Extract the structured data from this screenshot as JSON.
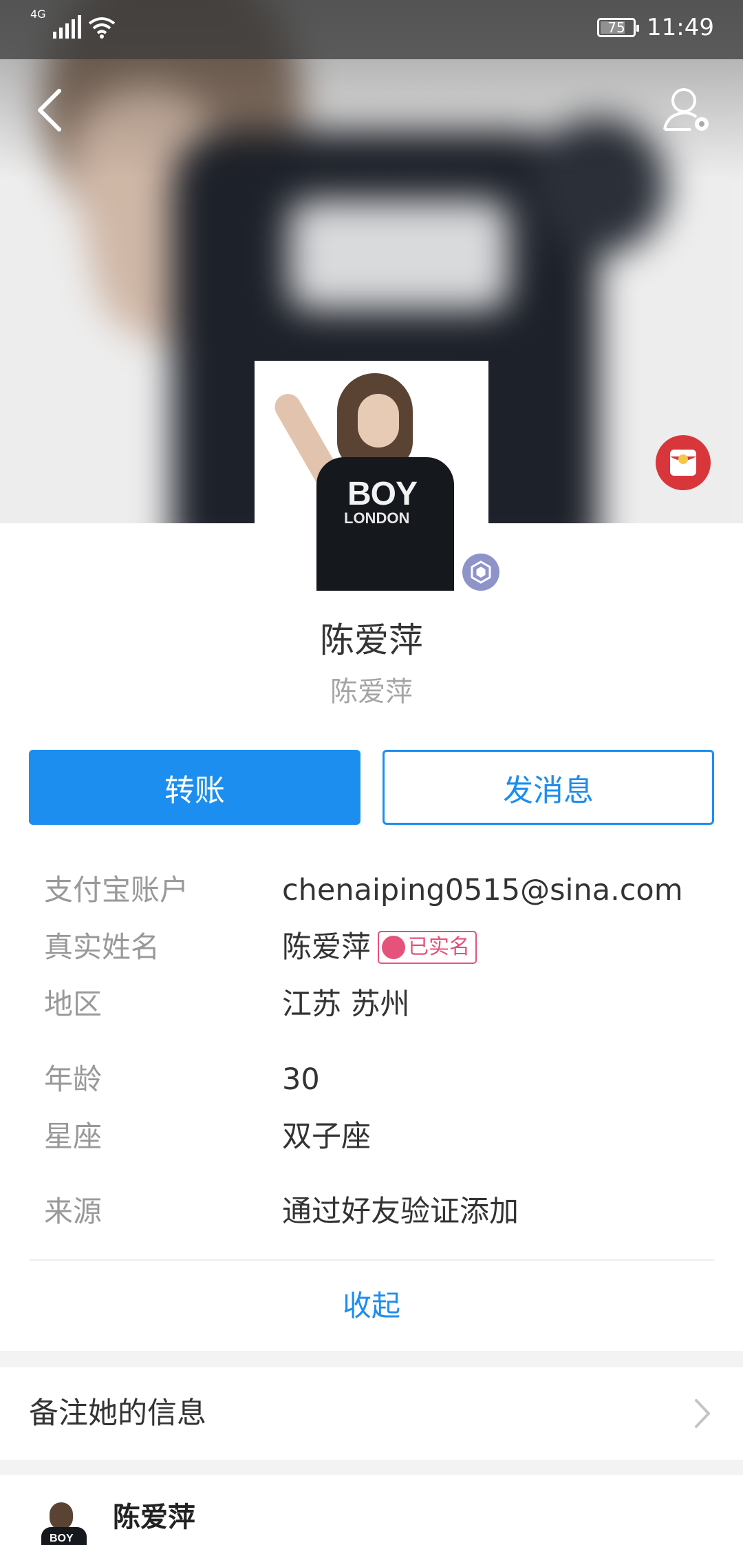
{
  "status_bar": {
    "network": "4G",
    "battery": "75",
    "time": "11:49"
  },
  "profile": {
    "display_name": "陈爱萍",
    "nickname": "陈爱萍",
    "avatar_shirt_text": "BOY",
    "avatar_shirt_subtext": "LONDON"
  },
  "actions": {
    "transfer_label": "转账",
    "message_label": "发消息"
  },
  "info": {
    "alipay_account": {
      "label": "支付宝账户",
      "value": "chenaiping0515@sina.com"
    },
    "real_name": {
      "label": "真实姓名",
      "value": "陈爱萍",
      "verified_badge": "已实名"
    },
    "region": {
      "label": "地区",
      "value": "江苏 苏州"
    },
    "age": {
      "label": "年龄",
      "value": "30"
    },
    "constellation": {
      "label": "星座",
      "value": "双子座"
    },
    "source": {
      "label": "来源",
      "value": "通过好友验证添加"
    }
  },
  "collapse_label": "收起",
  "remark": {
    "label": "备注她的信息"
  },
  "feed": {
    "name": "陈爱萍",
    "thumb_text": "BOY"
  },
  "colors": {
    "accent": "#1b8ef0",
    "verified": "#e5527a",
    "red_packet": "#d9363b",
    "badge": "#8e93c9"
  }
}
